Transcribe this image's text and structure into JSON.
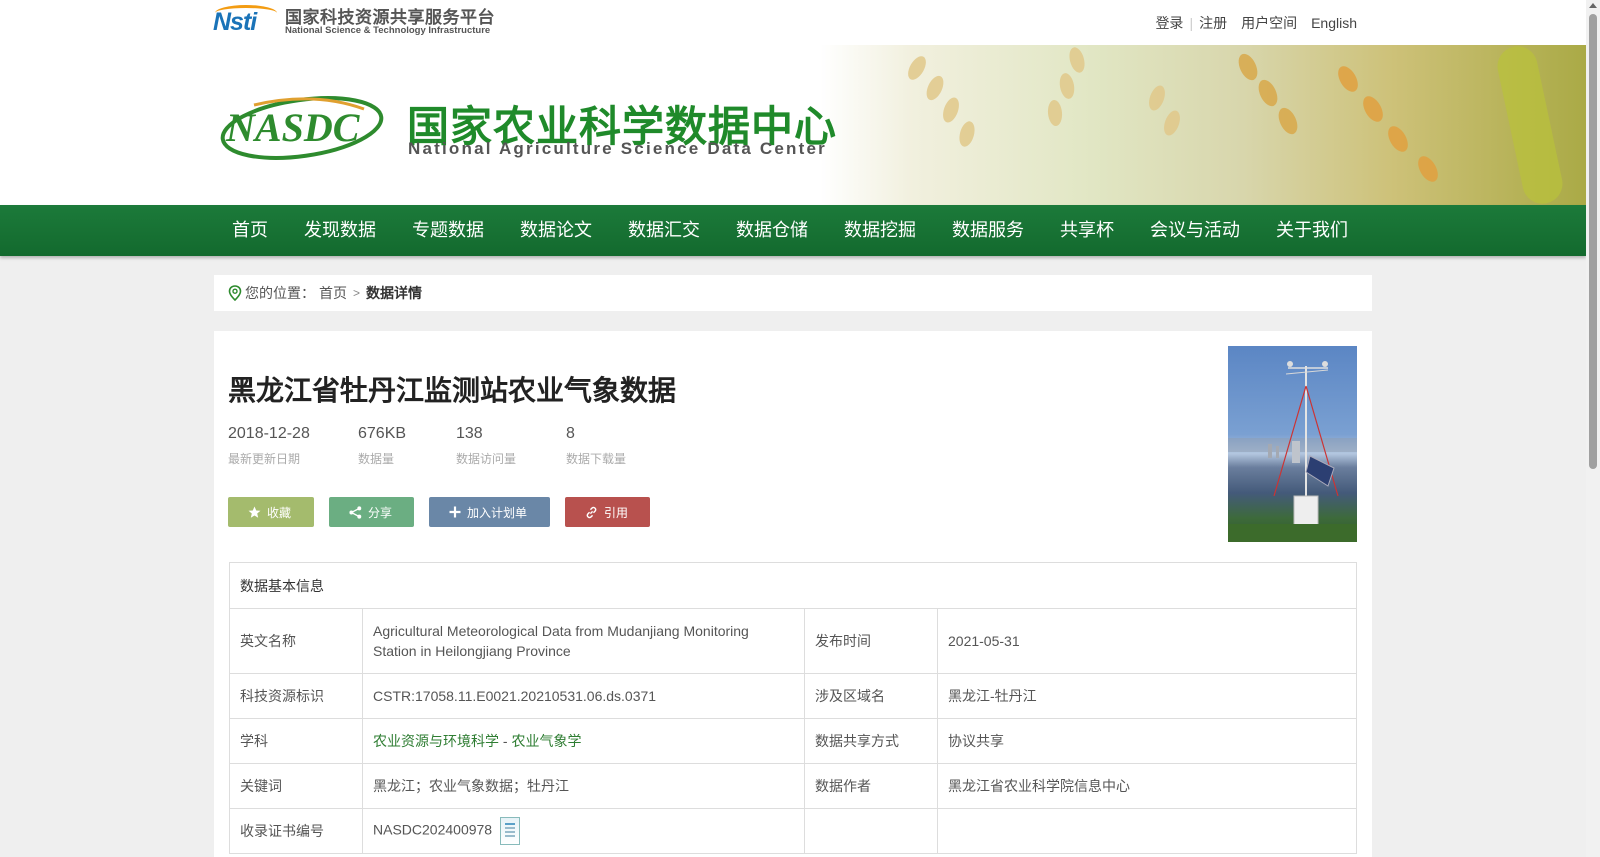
{
  "top": {
    "platform_logo_cn": "国家科技资源共享服务平台",
    "platform_logo_en": "National Science & Technology Infrastructure",
    "platform_logo_mark": "Nsti",
    "links": {
      "login": "登录",
      "register": "注册",
      "user_space": "用户空间",
      "english": "English"
    }
  },
  "banner": {
    "title_cn": "国家农业科学数据中心",
    "title_en": "National Agriculture Science Data Center",
    "logo_text": "NASDC"
  },
  "nav": {
    "items": [
      "首页",
      "发现数据",
      "专题数据",
      "数据论文",
      "数据汇交",
      "数据仓储",
      "数据挖掘",
      "数据服务",
      "共享杯",
      "会议与活动",
      "关于我们"
    ]
  },
  "breadcrumb": {
    "label": "您的位置：",
    "home": "首页",
    "current": "数据详情"
  },
  "dataset": {
    "title": "黑龙江省牡丹江监测站农业气象数据",
    "stats": [
      {
        "value": "2018-12-28",
        "label": "最新更新日期"
      },
      {
        "value": "676KB",
        "label": "数据量"
      },
      {
        "value": "138",
        "label": "数据访问量"
      },
      {
        "value": "8",
        "label": "数据下载量"
      }
    ],
    "buttons": {
      "favorite": "收藏",
      "share": "分享",
      "add_plan": "加入计划单",
      "cite": "引用"
    }
  },
  "info": {
    "header": "数据基本信息",
    "rows": [
      {
        "k1": "英文名称",
        "v1": "Agricultural Meteorological Data from Mudanjiang Monitoring Station in Heilongjiang Province",
        "k2": "发布时间",
        "v2": "2021-05-31"
      },
      {
        "k1": "科技资源标识",
        "v1": "CSTR:17058.11.E0021.20210531.06.ds.0371",
        "k2": "涉及区域名",
        "v2": "黑龙江-牡丹江"
      },
      {
        "k1": "学科",
        "v1a": "农业资源与环境科学",
        "v1sep": " - ",
        "v1b": "农业气象学",
        "k2": "数据共享方式",
        "v2": "协议共享"
      },
      {
        "k1": "关键词",
        "v1": "黑龙江；农业气象数据；牡丹江",
        "k2": "数据作者",
        "v2": "黑龙江省农业科学院信息中心"
      },
      {
        "k1": "收录证书编号",
        "v1": "NASDC202400978",
        "k2": "",
        "v2": ""
      }
    ]
  },
  "colors": {
    "nav_green": "#1c7a3a",
    "brand_green": "#1f8a2a",
    "favorite": "#a4bb6d",
    "share": "#6bae82",
    "plan": "#6a87a7",
    "cite": "#b8514e",
    "link_green": "#2e7d32"
  },
  "icons": {
    "location": "location-pin-icon",
    "favorite": "star-icon",
    "share": "share-icon",
    "plan": "plus-icon",
    "cite": "link-icon",
    "certificate": "certificate-icon"
  }
}
